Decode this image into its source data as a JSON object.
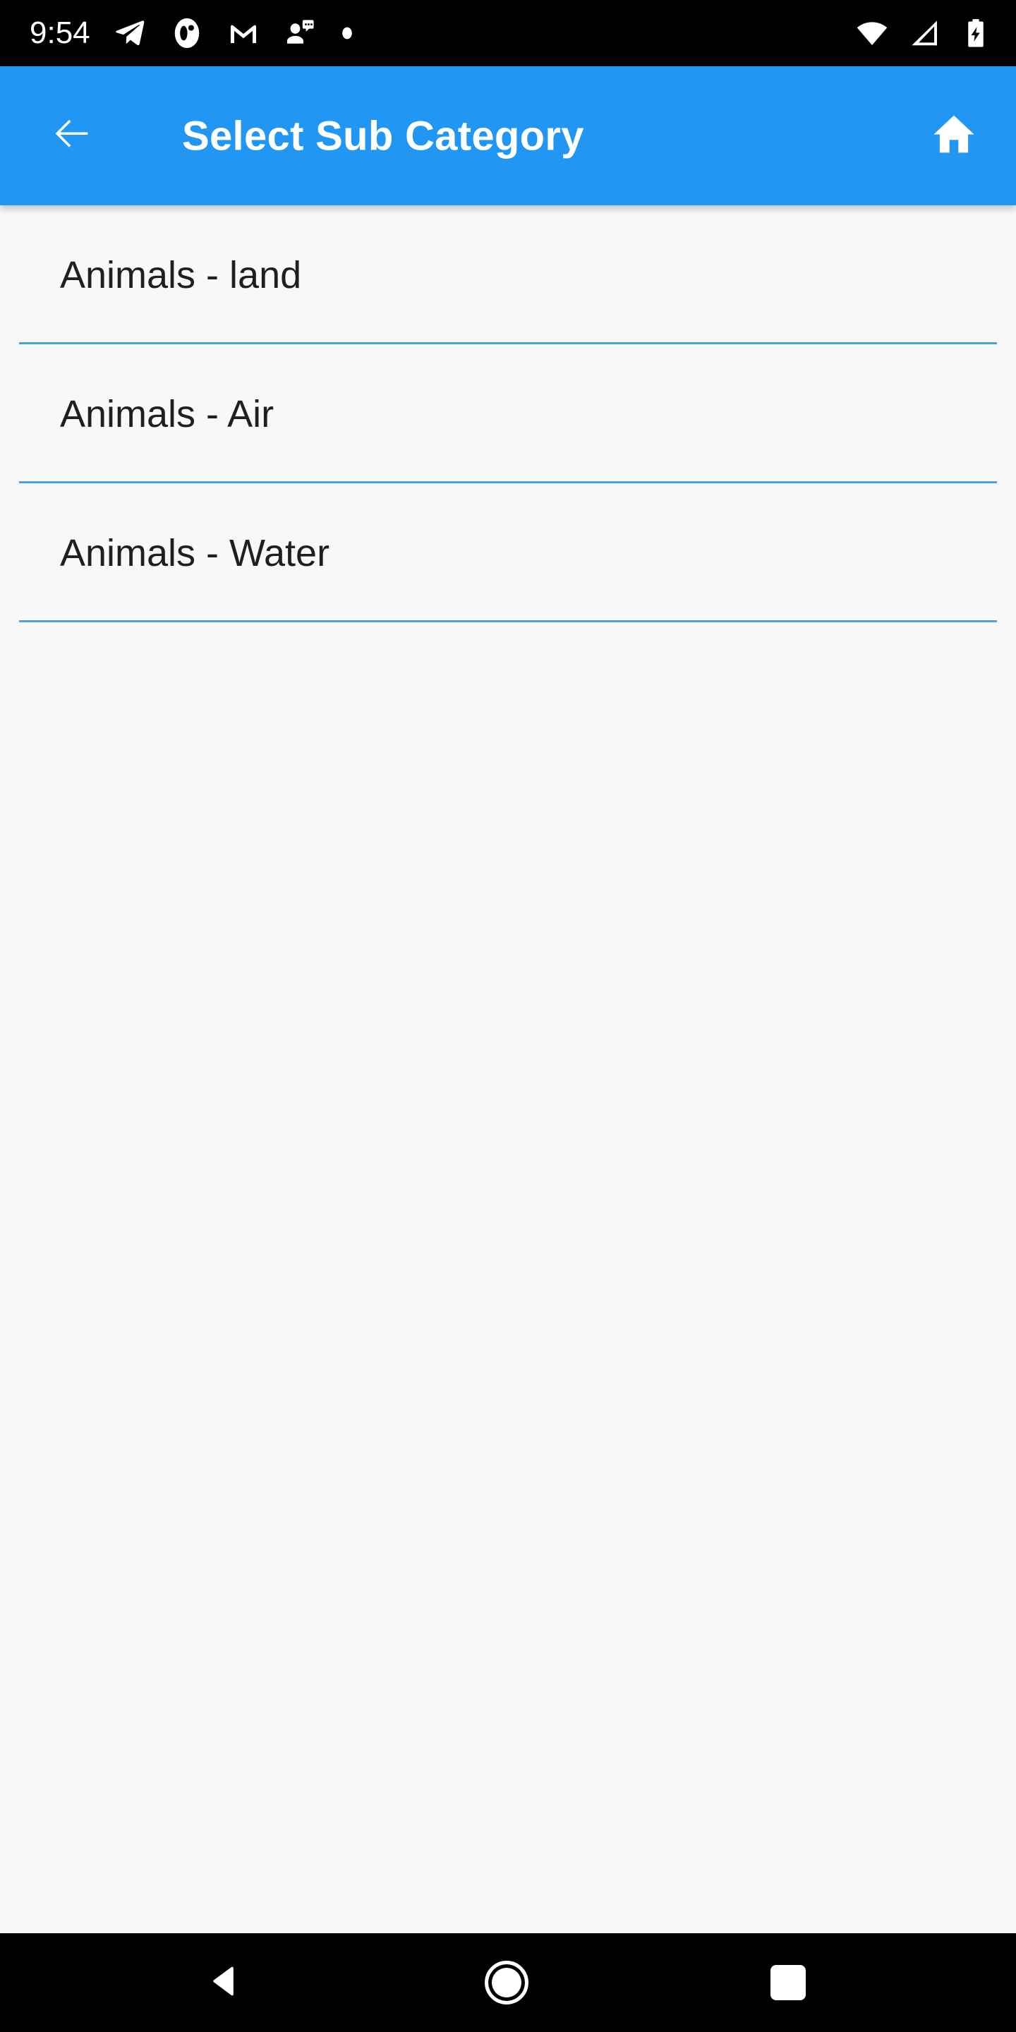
{
  "status_bar": {
    "time": "9:54",
    "background_color": "#000000",
    "foreground_color": "#FFFFFF",
    "notification_icons": [
      {
        "name": "telegram-icon",
        "label": "Telegram"
      },
      {
        "name": "app-circle-icon",
        "label": "App notification"
      },
      {
        "name": "gmail-icon",
        "label": "Gmail"
      },
      {
        "name": "person-message-icon",
        "label": "Message"
      },
      {
        "name": "more-notifications-dot-icon",
        "label": "More"
      }
    ],
    "system_icons": [
      {
        "name": "wifi-icon",
        "label": "Wi-Fi"
      },
      {
        "name": "cellular-signal-icon",
        "label": "Mobile signal"
      },
      {
        "name": "battery-charging-icon",
        "label": "Battery charging"
      }
    ]
  },
  "app_bar": {
    "title": "Select Sub Category",
    "background_color": "#2196F3",
    "title_color": "#FFFFFF",
    "back_icon": "arrow-back-icon",
    "home_icon": "home-icon"
  },
  "list": {
    "background_color": "#F8F8F8",
    "divider_color": "#4BA3E3",
    "text_color": "#1F1F1F",
    "items": [
      {
        "label": "Animals - land"
      },
      {
        "label": "Animals - Air"
      },
      {
        "label": "Animals - Water"
      }
    ]
  },
  "nav_bar": {
    "background_color": "#000000",
    "buttons": [
      {
        "name": "nav-back-button",
        "icon": "triangle-back-icon",
        "label": "Back"
      },
      {
        "name": "nav-home-button",
        "icon": "circle-home-icon",
        "label": "Home"
      },
      {
        "name": "nav-recent-button",
        "icon": "square-recents-icon",
        "label": "Recent apps"
      }
    ]
  }
}
